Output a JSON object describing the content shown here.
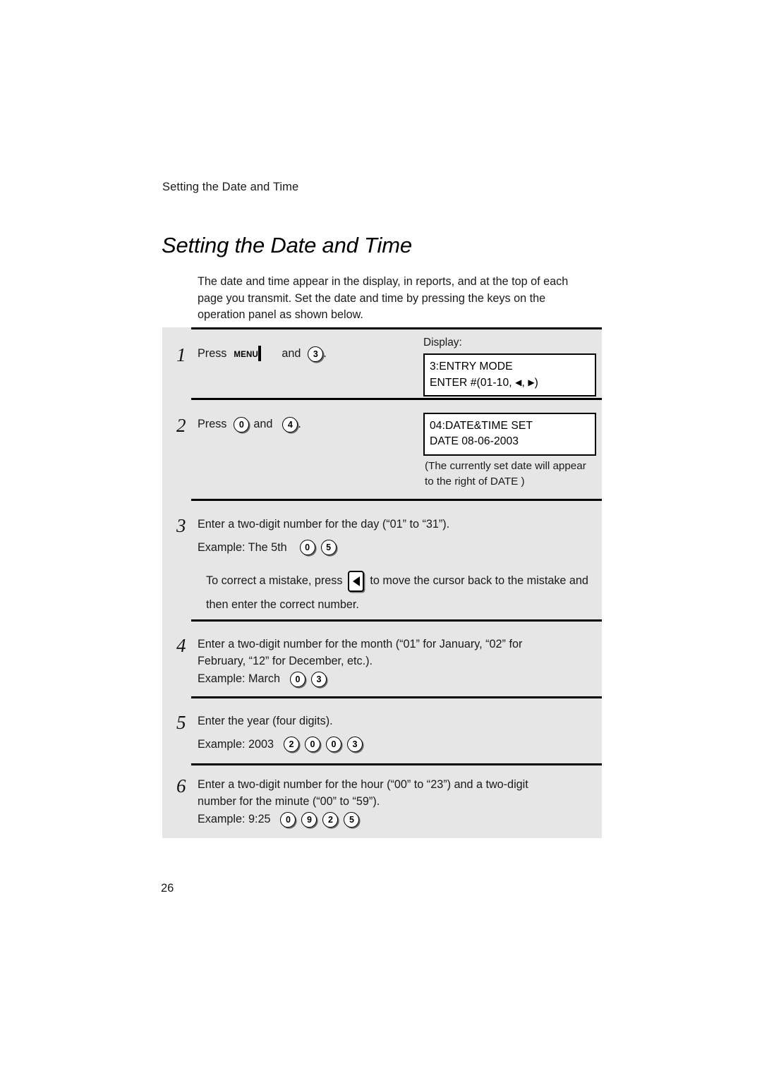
{
  "header": {
    "running_head": "Setting the Date and Time"
  },
  "title": "Setting the Date and Time",
  "intro": {
    "line1": "The date and time appear in the display, in reports, and at the top of each",
    "line2": "page you transmit. Set the date and time by pressing the keys on the",
    "line3": "operation panel as shown below."
  },
  "steps": [
    {
      "number": "1",
      "press_label": "Press",
      "menu_key_label": "MENU",
      "and_label": "and",
      "key": "3",
      "period": ".",
      "display_label": "Display:",
      "lcd": {
        "line1": "3:ENTRY MODE",
        "line2_pre": "ENTER #(01-10,",
        "left_arrow": "◀",
        "comma": ",",
        "right_arrow": "▶",
        "line2_post": ")"
      }
    },
    {
      "number": "2",
      "press_label": "Press",
      "key1": "0",
      "and_label": "and",
      "key2": "4",
      "period": ".",
      "lcd": {
        "line1": "04:DATE&TIME SET",
        "line2": "DATE 08-06-2003"
      },
      "note_line1": "(The currently set date will appear",
      "note_line2": "to the right of  DATE )"
    },
    {
      "number": "3",
      "text": "Enter a two-digit number for the day (“01” to “31”).",
      "example_label": "Example: The 5th",
      "example_keys": [
        "0",
        "5"
      ],
      "tip_pre": "To correct a mistake, press",
      "tip_post": "to move the cursor back to the mistake and",
      "tip_line2": "then enter the correct number.",
      "arrow_key": "left-arrow"
    },
    {
      "number": "4",
      "text_line1": "Enter a two-digit number for the month (“01” for January, “02” for",
      "text_line2": "February, “12” for December, etc.).",
      "example_label": "Example: March",
      "example_keys": [
        "0",
        "3"
      ]
    },
    {
      "number": "5",
      "text": "Enter the year (four digits).",
      "example_label": "Example: 2003",
      "example_keys": [
        "2",
        "0",
        "0",
        "3"
      ]
    },
    {
      "number": "6",
      "text_line1": "Enter a two-digit number for the hour (“00” to “23”) and a two-digit",
      "text_line2": "number for the minute (“00” to “59”).",
      "example_label": "Example: 9:25",
      "example_keys": [
        "0",
        "9",
        "2",
        "5"
      ]
    }
  ],
  "folio": "26",
  "colors": {
    "panel_background": "#e6e6e6",
    "page_background": "#ffffff",
    "ink": "#000000"
  }
}
